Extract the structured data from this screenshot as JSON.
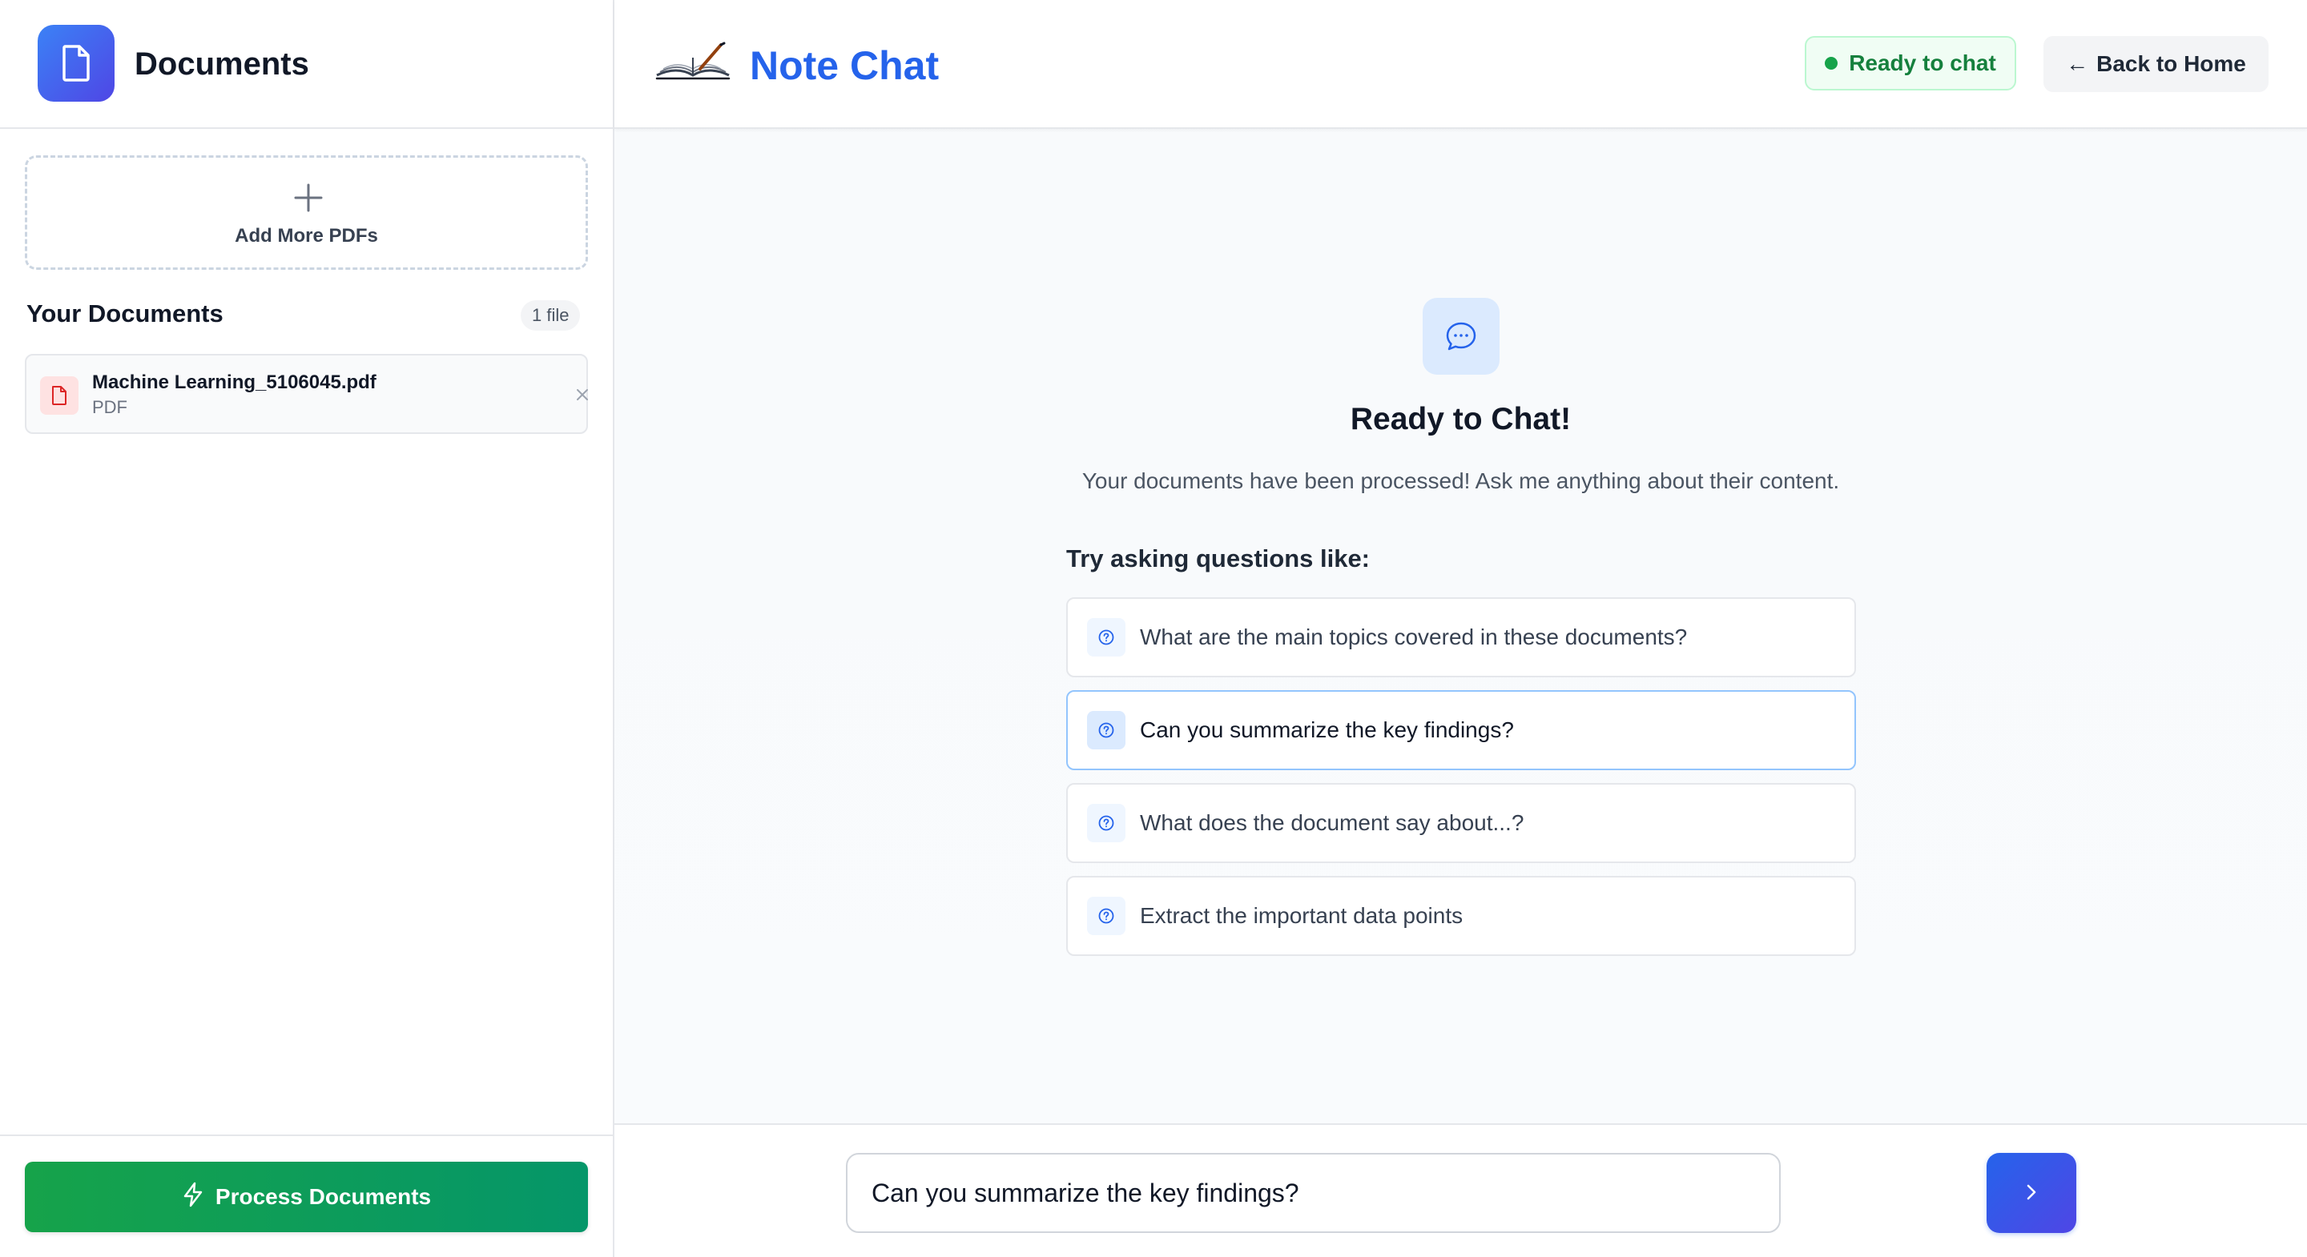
{
  "sidebar": {
    "title": "Documents",
    "upload_label": "Add More PDFs",
    "section_title": "Your Documents",
    "file_count": "1 file",
    "documents": [
      {
        "name": "Machine Learning_5106045.pdf",
        "type": "PDF"
      }
    ],
    "process_button": "Process Documents"
  },
  "header": {
    "app_title": "Note Chat",
    "status": "Ready to chat",
    "back_button": "Back to Home",
    "back_arrow": "←"
  },
  "welcome": {
    "title": "Ready to Chat!",
    "subtitle": "Your documents have been processed! Ask me anything about their content.",
    "suggestions_title": "Try asking questions like:",
    "suggestions": [
      "What are the main topics covered in these documents?",
      "Can you summarize the key findings?",
      "What does the document say about...?",
      "Extract the important data points"
    ]
  },
  "chat": {
    "input_value": "Can you summarize the key findings?"
  },
  "colors": {
    "brand_blue": "#2563eb",
    "success_green": "#16a34a",
    "pdf_red": "#dc2626"
  },
  "icons": {
    "sidebar_logo": "document-icon",
    "upload": "plus-icon",
    "pdf": "pdf-file-icon",
    "remove": "close-icon",
    "process": "lightning-icon",
    "brand": "open-book-icon",
    "welcome": "chat-bubble-icon",
    "suggestion": "question-circle-icon",
    "send": "chevron-right-icon"
  }
}
